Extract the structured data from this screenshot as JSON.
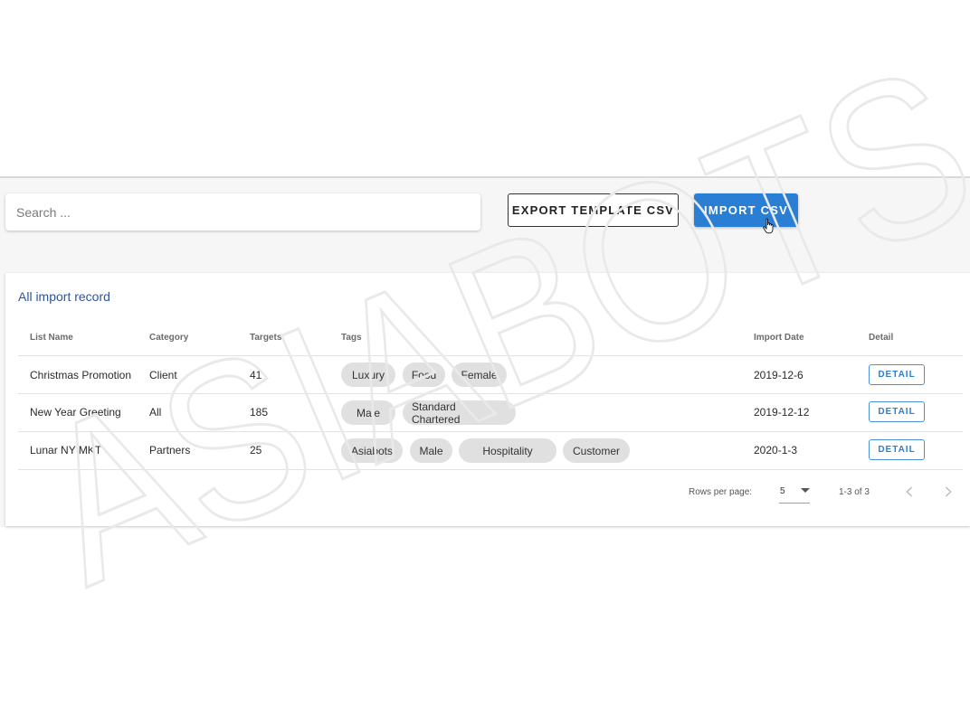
{
  "search": {
    "placeholder": "Search ..."
  },
  "toolbar": {
    "export_label": "EXPORT TEMPLATE CSV",
    "import_label": "IMPORT CSV",
    "import_color": "#2a7fd4"
  },
  "card": {
    "title": "All import record",
    "columns": [
      "List Name",
      "Category",
      "Targets",
      "Tags",
      "Import Date",
      "Detail"
    ],
    "rows": [
      {
        "list_name": "Christmas Promotion",
        "category": "Client",
        "targets": "41",
        "tags": [
          "Luxury",
          "Food",
          "Female"
        ],
        "import_date": "2019-12-6",
        "detail": "DETAIL"
      },
      {
        "list_name": "New Year Greeting",
        "category": "All",
        "targets": "185",
        "tags": [
          "Male",
          "Standard Chartered"
        ],
        "import_date": "2019-12-12",
        "detail": "DETAIL"
      },
      {
        "list_name": "Lunar NY MKT",
        "category": "Partners",
        "targets": "25",
        "tags": [
          "Asiabots",
          "Male",
          "Hospitality",
          "Customer"
        ],
        "import_date": "2020-1-3",
        "detail": "DETAIL"
      }
    ]
  },
  "pagination": {
    "rows_per_page_label": "Rows per page:",
    "rows_per_page_value": "5",
    "range_text": "1-3 of 3"
  },
  "watermark": {
    "text": "ASIABOTS"
  }
}
